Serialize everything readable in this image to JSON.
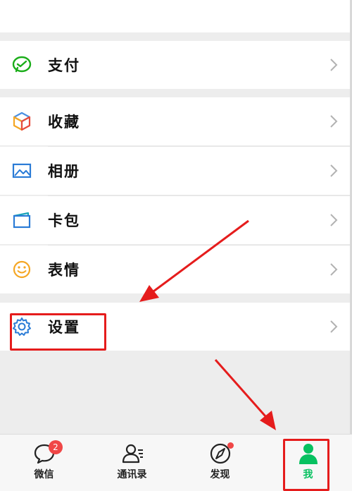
{
  "menu": {
    "pay": {
      "label": "支付",
      "icon": "wechat-pay-icon"
    },
    "favorites": {
      "label": "收藏",
      "icon": "cube-icon"
    },
    "album": {
      "label": "相册",
      "icon": "photo-icon"
    },
    "cards": {
      "label": "卡包",
      "icon": "card-wallet-icon"
    },
    "stickers": {
      "label": "表情",
      "icon": "smiley-icon"
    },
    "settings": {
      "label": "设置",
      "icon": "gear-icon"
    }
  },
  "tabbar": {
    "tabs": [
      {
        "label": "微信",
        "icon": "chat-bubble-icon",
        "badge": "2"
      },
      {
        "label": "通讯录",
        "icon": "contacts-icon"
      },
      {
        "label": "发现",
        "icon": "compass-icon",
        "dot": true
      },
      {
        "label": "我",
        "icon": "person-icon",
        "active": true
      }
    ]
  },
  "colors": {
    "accent": "#07c160",
    "badge": "#f04747",
    "annotation": "#e51c1c",
    "background": "#ededed"
  }
}
